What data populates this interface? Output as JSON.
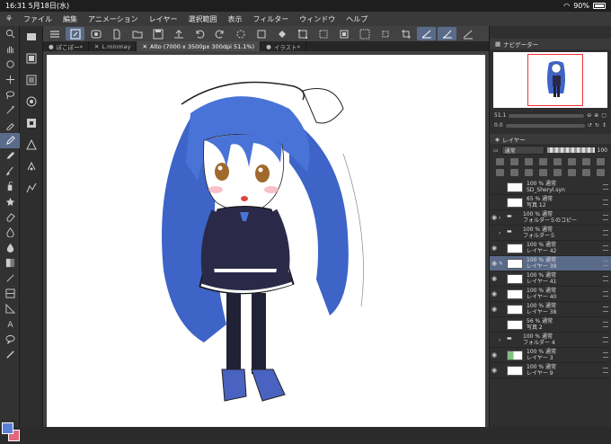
{
  "status": {
    "time": "16:31",
    "date": "5月18日(水)",
    "battery": "90%"
  },
  "menu": [
    "ファイル",
    "編集",
    "アニメーション",
    "レイヤー",
    "選択範囲",
    "表示",
    "フィルター",
    "ウィンドウ",
    "ヘルプ"
  ],
  "tabs": [
    {
      "label": "ぽこぽー*"
    },
    {
      "label": "L.minmay"
    },
    {
      "label": "Alto (7000 x 3500px 300dpi 51.1%)"
    },
    {
      "label": "イラスト*"
    }
  ],
  "navigator": {
    "title": "ナビゲーター",
    "zoom": "51.1",
    "angle": "0.0"
  },
  "layer_panel": {
    "title": "レイヤー",
    "blend": "通常",
    "opacity": "100"
  },
  "layers": [
    {
      "l1": "100 % 通常",
      "l2": "SD_Sheryl.syn",
      "eye": false
    },
    {
      "l1": "65 % 通常",
      "l2": "写真 12",
      "eye": false
    },
    {
      "l1": "100 % 通常",
      "l2": "フォルダー５のコピー",
      "eye": true,
      "folder": true
    },
    {
      "l1": "100 % 通常",
      "l2": "フォルダー５",
      "eye": false,
      "folder": true
    },
    {
      "l1": "100 % 通常",
      "l2": "レイヤー 42",
      "eye": true
    },
    {
      "l1": "100 % 通常",
      "l2": "レイヤー 39",
      "eye": true,
      "sel": true
    },
    {
      "l1": "100 % 通常",
      "l2": "レイヤー 41",
      "eye": true
    },
    {
      "l1": "100 % 通常",
      "l2": "レイヤー 40",
      "eye": true
    },
    {
      "l1": "100 % 通常",
      "l2": "レイヤー 38",
      "eye": true
    },
    {
      "l1": "56 % 通常",
      "l2": "写真 2",
      "eye": false
    },
    {
      "l1": "100 % 通常",
      "l2": "フォルダー 4",
      "eye": false,
      "folder": true
    },
    {
      "l1": "100 % 通常",
      "l2": "レイヤー 3",
      "eye": true
    },
    {
      "l1": "100 % 通常",
      "l2": "レイヤー 9",
      "eye": true
    }
  ],
  "colors": {
    "accent": "#5a6b8a",
    "main": "#5b7fd6",
    "sub": "#e4677c"
  }
}
